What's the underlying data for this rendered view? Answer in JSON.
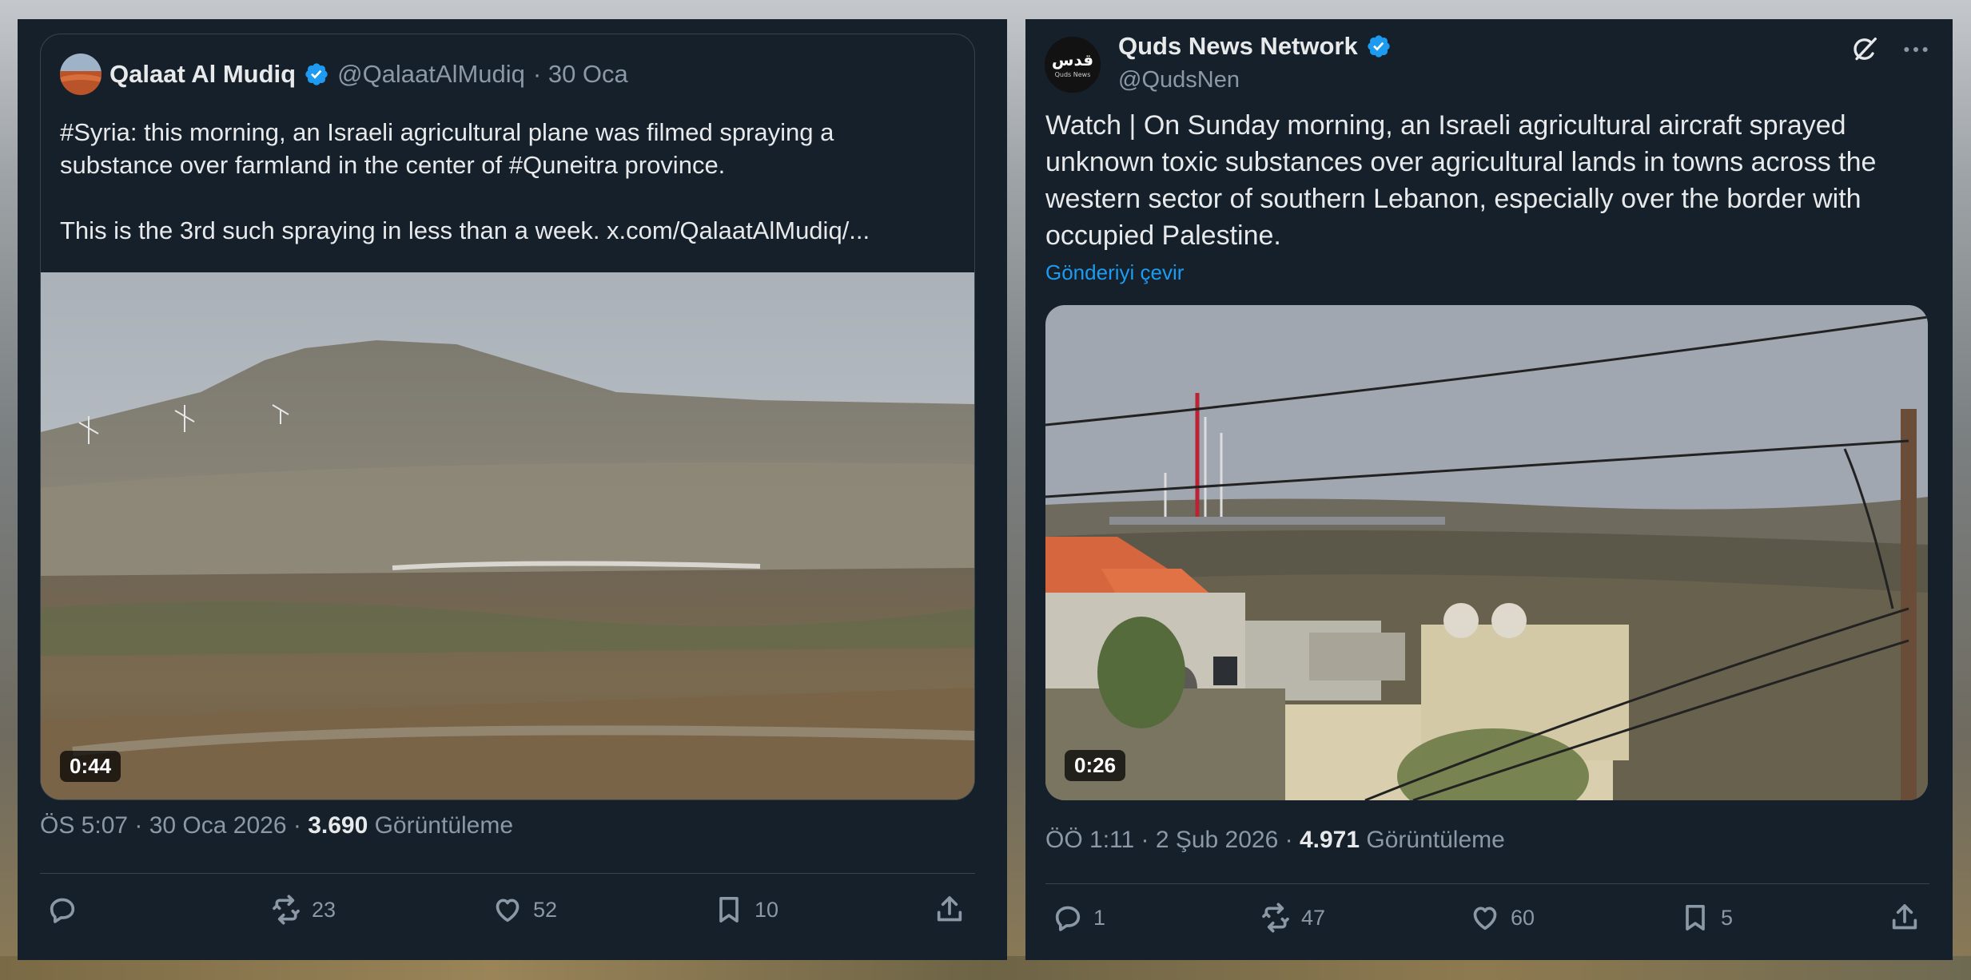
{
  "left_tweet": {
    "author_name": "Qalaat Al Mudiq",
    "handle": "@QalaatAlMudiq",
    "date": "· 30 Oca",
    "text_lines": [
      "#Syria: this morning, an Israeli agricultural plane was filmed spraying a",
      "substance over farmland in the center of #Quneitra province."
    ],
    "text_line_3": "This is the 3rd such spraying in less than a week.  x.com/QalaatAlMudiq/...",
    "video_duration": "0:44",
    "timestamp": "ÖS 5:07 · 30 Oca 2026 · ",
    "views_count": "3.690",
    "views_label": " Görüntüleme",
    "replies": "",
    "reposts": "23",
    "likes": "52",
    "bookmarks": "10"
  },
  "right_tweet": {
    "author_name": "Quds News Network",
    "handle": "@QudsNen",
    "avatar_text": "قدس",
    "avatar_subtext": "Quds News",
    "text_lines": [
      "Watch | On Sunday morning, an Israeli agricultural aircraft sprayed",
      "unknown toxic substances over agricultural lands in towns across the",
      "western sector of southern Lebanon, especially over the border with",
      "occupied Palestine."
    ],
    "translate_link": "Gönderiyi çevir",
    "video_duration": "0:26",
    "timestamp": "ÖÖ 1:11 · 2 Şub 2026 · ",
    "views_count": "4.971",
    "views_label": " Görüntüleme",
    "replies": "1",
    "reposts": "47",
    "likes": "60",
    "bookmarks": "5"
  },
  "colors": {
    "background": "#15202b",
    "text": "#e7e9ea",
    "muted": "#8b98a5",
    "border": "#38444d",
    "verified": "#1d9bf0",
    "link": "#1d9bf0"
  },
  "icons": [
    "verified-badge-icon",
    "reply-icon",
    "repost-icon",
    "like-icon",
    "bookmark-icon",
    "share-icon",
    "grok-icon",
    "more-icon"
  ]
}
